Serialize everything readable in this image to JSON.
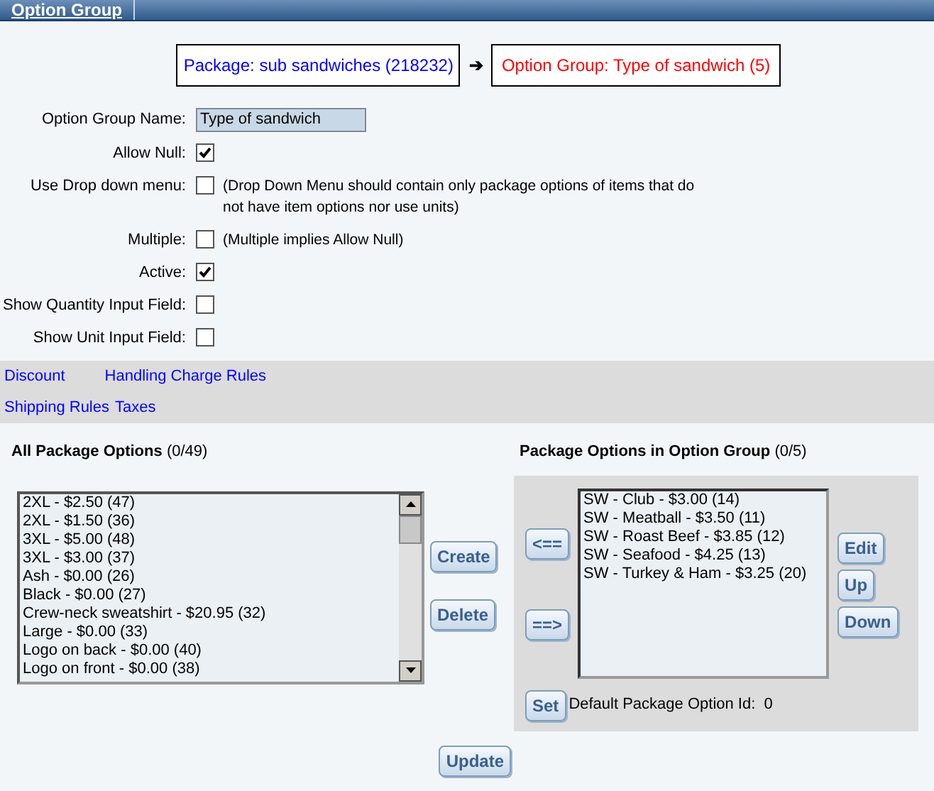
{
  "header": {
    "title": "Option Group"
  },
  "breadcrumb": {
    "package": "Package: sub sandwiches (218232)",
    "arrow": "➔",
    "option_group": "Option Group: Type of sandwich (5)"
  },
  "fields": [
    {
      "kind": "text",
      "label": "Option Group Name:",
      "value": "Type of sandwich"
    },
    {
      "kind": "checkbox",
      "label": "Allow Null:",
      "checked": true
    },
    {
      "kind": "checkbox",
      "label": "Use Drop down menu:",
      "checked": false,
      "note": "(Drop Down Menu should contain only package options of items that do not have item options nor use units)"
    },
    {
      "kind": "checkbox",
      "label": "Multiple:",
      "checked": false,
      "note": "(Multiple implies Allow Null)"
    },
    {
      "kind": "checkbox",
      "label": "Active:",
      "checked": true
    },
    {
      "kind": "checkbox",
      "label": "Show Quantity Input Field:",
      "checked": false
    },
    {
      "kind": "checkbox",
      "label": "Show Unit Input Field:",
      "checked": false
    }
  ],
  "links": [
    [
      "Discount",
      "Handling Charge Rules"
    ],
    [
      "Shipping Rules",
      "Taxes"
    ]
  ],
  "all_options": {
    "title": "All Package Options",
    "count": "(0/49)",
    "items": [
      "2XL - $2.50 (47)",
      "2XL - $1.50 (36)",
      "3XL - $5.00 (48)",
      "3XL - $3.00 (37)",
      "Ash - $0.00 (26)",
      "Black - $0.00 (27)",
      "Crew-neck sweatshirt - $20.95 (32)",
      "Large - $0.00 (33)",
      "Logo on back - $0.00 (40)",
      "Logo on front - $0.00 (38)"
    ],
    "buttons": [
      "Create",
      "Delete"
    ]
  },
  "group_options": {
    "title": "Package Options in Option Group",
    "count": "(0/5)",
    "move_buttons": [
      "<==",
      "==>"
    ],
    "items": [
      "SW - Club - $3.00 (14)",
      "SW - Meatball - $3.50 (11)",
      "SW - Roast Beef - $3.85 (12)",
      "SW - Seafood - $4.25 (13)",
      "SW - Turkey & Ham - $3.25 (20)"
    ],
    "side_buttons": [
      "Edit",
      "Up",
      "Down"
    ],
    "set_button": "Set",
    "default_label": "Default Package Option Id:",
    "default_value": "0"
  },
  "update_button": "Update"
}
